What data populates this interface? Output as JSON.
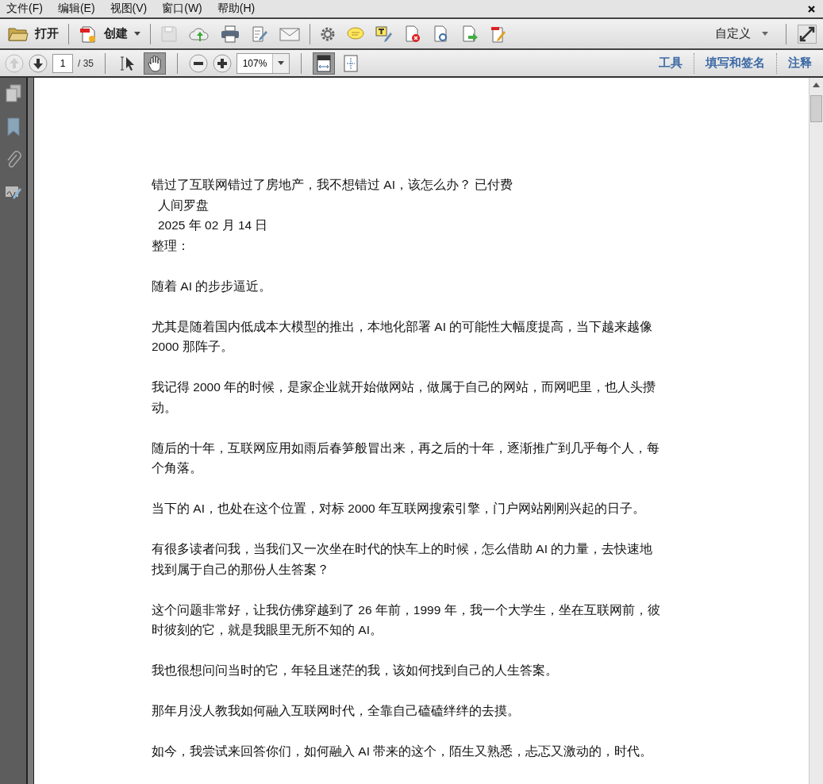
{
  "menu": [
    "文件(F)",
    "编辑(E)",
    "视图(V)",
    "窗口(W)",
    "帮助(H)"
  ],
  "toolbar": {
    "open_label": "打开",
    "create_label": "创建",
    "save_disabled": true,
    "custom_label": "自定义"
  },
  "nav": {
    "prev_disabled": true,
    "next_disabled": false,
    "page": "1",
    "page_total": "/ 35",
    "zoom": "107%",
    "tools": [
      {
        "kind": "select",
        "selected": false
      },
      {
        "kind": "hand",
        "selected": true
      }
    ],
    "fits": [
      {
        "kind": "width",
        "selected": true
      },
      {
        "kind": "page",
        "selected": false
      }
    ]
  },
  "panels": [
    "工具",
    "填写和签名",
    "注释"
  ],
  "document": {
    "header": [
      {
        "text": "错过了互联网错过了房地产，我不想错过 AI，该怎么办？  已付费",
        "indent": false
      },
      {
        "text": "人间罗盘",
        "indent": true
      },
      {
        "text": "2025 年 02 月 14 日",
        "indent": true
      },
      {
        "text": "整理：",
        "indent": false
      }
    ],
    "paragraphs": [
      [
        "随着 AI 的步步逼近。"
      ],
      [
        "尤其是随着国内低成本大模型的推出，本地化部署 AI 的可能性大幅度提高，当下越来越像",
        "2000 那阵子。"
      ],
      [
        "我记得 2000 年的时候，是家企业就开始做网站，做属于自己的网站，而网吧里，也人头攒",
        "动。"
      ],
      [
        "随后的十年，互联网应用如雨后春笋般冒出来，再之后的十年，逐渐推广到几乎每个人，每",
        "个角落。"
      ],
      [
        "当下的 AI，也处在这个位置，对标 2000 年互联网搜索引擎，门户网站刚刚兴起的日子。"
      ],
      [
        "有很多读者问我，当我们又一次坐在时代的快车上的时候，怎么借助 AI 的力量，去快速地",
        "找到属于自己的那份人生答案？"
      ],
      [
        "这个问题非常好，让我仿佛穿越到了 26 年前，1999 年，我一个大学生，坐在互联网前，彼",
        "时彼刻的它，就是我眼里无所不知的 AI。"
      ],
      [
        "我也很想问问当时的它，年轻且迷茫的我，该如何找到自己的人生答案。"
      ],
      [
        "那年月没人教我如何融入互联网时代，全靠自己磕磕绊绊的去摸。"
      ],
      [
        "如今，我尝试来回答你们，如何融入 AI 带来的这个，陌生又熟悉，忐忑又激动的，时代。"
      ]
    ]
  }
}
